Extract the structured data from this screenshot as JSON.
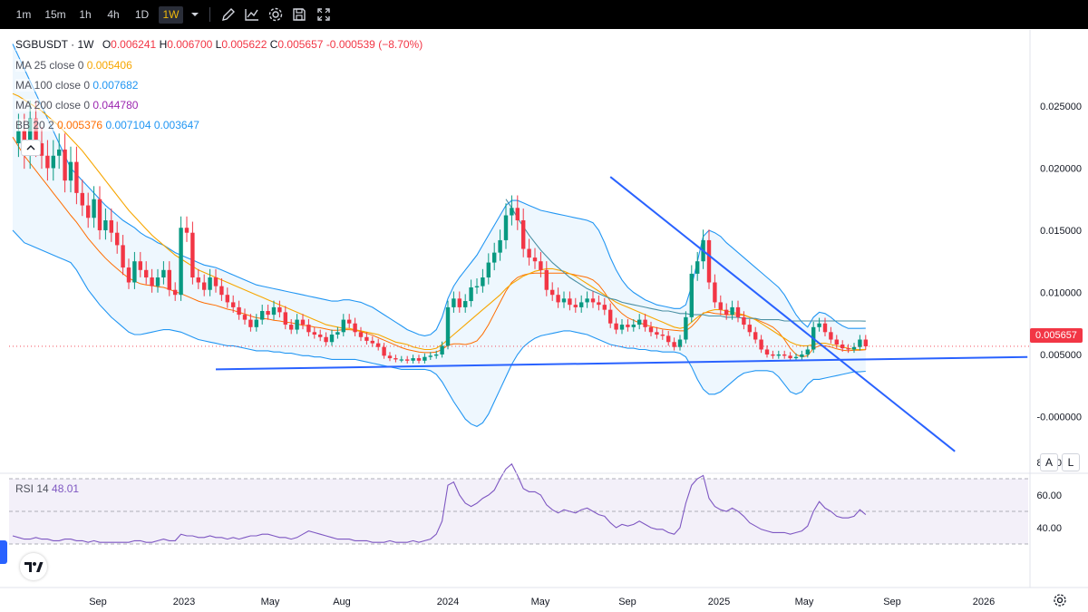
{
  "toolbar": {
    "timeframes": [
      "1m",
      "15m",
      "1h",
      "4h",
      "1D",
      "1W"
    ],
    "active": "1W",
    "icons": [
      "chevron-down-icon",
      "draw-icon",
      "indicators-icon",
      "settings-icon",
      "save-icon",
      "fullscreen-icon"
    ]
  },
  "legend": {
    "symbol": "SGBUSDT · 1W",
    "o_label": "O",
    "o": "0.006241",
    "h_label": "H",
    "h": "0.006700",
    "l_label": "L",
    "l": "0.005622",
    "c_label": "C",
    "c": "0.005657",
    "change": "-0.000539 (−8.70%)",
    "ma25_label": "MA 25 close 0",
    "ma25": "0.005406",
    "ma100_label": "MA 100 close 0",
    "ma100": "0.007682",
    "ma200_label": "MA 200 close 0",
    "ma200": "0.044780",
    "bb_label": "BB 20 2",
    "bb_basis": "0.005376",
    "bb_upper": "0.007104",
    "bb_lower": "0.003647"
  },
  "last_price": "0.005657",
  "rsi": {
    "label": "RSI 14",
    "value": "48.01"
  },
  "scale_buttons": [
    "A",
    "L"
  ],
  "colors": {
    "up": "#089981",
    "down": "#f23645",
    "ma25": "#f7a600",
    "ma100": "#2196f3",
    "bb": "#2196f3",
    "rsi": "#7e57c2",
    "trendline": "#2962ff"
  },
  "chart_data": {
    "type": "candlestick",
    "symbol": "SGBUSDT",
    "interval": "1W",
    "x_ticks": [
      "Sep",
      "2023",
      "May",
      "Aug",
      "2024",
      "May",
      "Sep",
      "2025",
      "May",
      "Sep",
      "2026"
    ],
    "y_ticks": [
      "0.025000",
      "0.020000",
      "0.015000",
      "0.010000",
      "0.005000",
      "-0.000000"
    ],
    "ylim": [
      -0.0042,
      0.0295
    ],
    "rsi_ticks": [
      "80.00",
      "60.00",
      "40.00"
    ],
    "rsi_ylim": [
      29,
      83
    ],
    "rsi_band": [
      30,
      70
    ],
    "grid": false,
    "closes": [
      0.022,
      0.023,
      0.021,
      0.024,
      0.022,
      0.021,
      0.02,
      0.021,
      0.0215,
      0.019,
      0.0205,
      0.018,
      0.017,
      0.016,
      0.0175,
      0.015,
      0.0158,
      0.0148,
      0.0138,
      0.012,
      0.0108,
      0.0125,
      0.0118,
      0.0112,
      0.0105,
      0.0112,
      0.0118,
      0.0102,
      0.0098,
      0.0152,
      0.0148,
      0.0112,
      0.0108,
      0.0102,
      0.0112,
      0.0105,
      0.0098,
      0.0092,
      0.0088,
      0.0082,
      0.0078,
      0.0072,
      0.0078,
      0.0085,
      0.0082,
      0.0088,
      0.0084,
      0.0074,
      0.007,
      0.0078,
      0.0074,
      0.0068,
      0.0066,
      0.0064,
      0.006,
      0.0066,
      0.0068,
      0.0078,
      0.0075,
      0.0068,
      0.0064,
      0.0061,
      0.0059,
      0.0056,
      0.0049,
      0.0047,
      0.0046,
      0.0046,
      0.0045,
      0.0047,
      0.0045,
      0.0048,
      0.0049,
      0.005,
      0.0057,
      0.0088,
      0.0095,
      0.0088,
      0.0093,
      0.0104,
      0.0105,
      0.0112,
      0.0124,
      0.0132,
      0.0142,
      0.0162,
      0.0168,
      0.0158,
      0.0135,
      0.0128,
      0.0125,
      0.0118,
      0.0102,
      0.0098,
      0.0092,
      0.0095,
      0.009,
      0.0088,
      0.0092,
      0.0095,
      0.0092,
      0.009,
      0.0086,
      0.0075,
      0.007,
      0.0074,
      0.0072,
      0.0074,
      0.0078,
      0.0072,
      0.0068,
      0.0066,
      0.0065,
      0.006,
      0.0056,
      0.0062,
      0.008,
      0.0115,
      0.0125,
      0.0142,
      0.0108,
      0.0092,
      0.0086,
      0.0082,
      0.0088,
      0.008,
      0.0074,
      0.0068,
      0.0062,
      0.0054,
      0.005,
      0.0049,
      0.005,
      0.0049,
      0.0047,
      0.0048,
      0.005,
      0.0054,
      0.0072,
      0.0075,
      0.0068,
      0.0062,
      0.0058,
      0.0055,
      0.0054,
      0.0056,
      0.0062,
      0.005657
    ],
    "bb_upper": [
      0.03,
      0.029,
      0.028,
      0.027,
      0.026,
      0.025,
      0.024,
      0.023,
      0.022,
      0.021,
      0.02,
      0.0195,
      0.019,
      0.0185,
      0.018,
      0.0175,
      0.017,
      0.0166,
      0.0162,
      0.0158,
      0.0155,
      0.0152,
      0.0148,
      0.0145,
      0.0143,
      0.014,
      0.0138,
      0.0135,
      0.0132,
      0.013,
      0.0128,
      0.0126,
      0.0124,
      0.0122,
      0.0121,
      0.012,
      0.0118,
      0.0116,
      0.0114,
      0.0112,
      0.011,
      0.0108,
      0.0106,
      0.0105,
      0.0104,
      0.0103,
      0.0102,
      0.0101,
      0.01,
      0.0099,
      0.0098,
      0.0097,
      0.0096,
      0.0095,
      0.0094,
      0.0093,
      0.0093,
      0.0094,
      0.0094,
      0.0093,
      0.0092,
      0.009,
      0.0088,
      0.0085,
      0.0082,
      0.0079,
      0.0076,
      0.0073,
      0.007,
      0.0068,
      0.0066,
      0.0065,
      0.0066,
      0.007,
      0.008,
      0.0095,
      0.0105,
      0.0112,
      0.0118,
      0.0124,
      0.013,
      0.0138,
      0.0146,
      0.0154,
      0.0162,
      0.017,
      0.0174,
      0.0174,
      0.0172,
      0.017,
      0.0168,
      0.0166,
      0.0165,
      0.0164,
      0.0163,
      0.0162,
      0.0161,
      0.016,
      0.0159,
      0.0158,
      0.0156,
      0.015,
      0.014,
      0.0128,
      0.0118,
      0.011,
      0.0104,
      0.01,
      0.0097,
      0.0094,
      0.0092,
      0.009,
      0.0089,
      0.0088,
      0.0087,
      0.0087,
      0.009,
      0.0105,
      0.0125,
      0.0145,
      0.015,
      0.0148,
      0.0145,
      0.014,
      0.0136,
      0.0132,
      0.0128,
      0.0124,
      0.012,
      0.0116,
      0.0112,
      0.0108,
      0.0104,
      0.0098,
      0.009,
      0.0082,
      0.0076,
      0.0072,
      0.008,
      0.0084,
      0.0083,
      0.008,
      0.0076,
      0.0073,
      0.0071,
      0.0071,
      0.0071,
      0.007104
    ],
    "bb_lower": [
      0.015,
      0.0145,
      0.014,
      0.0138,
      0.0136,
      0.0134,
      0.0132,
      0.013,
      0.0128,
      0.0126,
      0.0124,
      0.0118,
      0.011,
      0.0102,
      0.0096,
      0.009,
      0.0085,
      0.008,
      0.0076,
      0.0072,
      0.0068,
      0.0066,
      0.0066,
      0.0067,
      0.0068,
      0.0069,
      0.007,
      0.007,
      0.0069,
      0.0068,
      0.0066,
      0.0064,
      0.0062,
      0.0061,
      0.006,
      0.0059,
      0.0058,
      0.0057,
      0.0057,
      0.0056,
      0.0055,
      0.0054,
      0.0053,
      0.0053,
      0.0053,
      0.0052,
      0.0052,
      0.0051,
      0.0051,
      0.005,
      0.0049,
      0.0049,
      0.0048,
      0.0048,
      0.0047,
      0.0046,
      0.0046,
      0.0046,
      0.0046,
      0.0046,
      0.0045,
      0.0044,
      0.0043,
      0.0042,
      0.0041,
      0.004,
      0.0039,
      0.0038,
      0.0038,
      0.0038,
      0.0038,
      0.0038,
      0.0037,
      0.0034,
      0.0028,
      0.002,
      0.0012,
      0.0005,
      -0.0002,
      -0.0006,
      -0.0008,
      -0.0005,
      0.0002,
      0.0012,
      0.0022,
      0.0032,
      0.0042,
      0.005,
      0.0056,
      0.006,
      0.0063,
      0.0065,
      0.0066,
      0.0067,
      0.0068,
      0.0069,
      0.0069,
      0.0068,
      0.0067,
      0.0066,
      0.0064,
      0.0062,
      0.006,
      0.0058,
      0.0057,
      0.0056,
      0.0055,
      0.0055,
      0.0054,
      0.0054,
      0.0053,
      0.0053,
      0.0052,
      0.0052,
      0.0052,
      0.0051,
      0.0048,
      0.004,
      0.003,
      0.0022,
      0.0018,
      0.0018,
      0.002,
      0.0024,
      0.0028,
      0.0032,
      0.0035,
      0.0036,
      0.0037,
      0.0037,
      0.0037,
      0.0036,
      0.0032,
      0.0026,
      0.002,
      0.0018,
      0.002,
      0.0026,
      0.003,
      0.003,
      0.0031,
      0.0032,
      0.0033,
      0.0034,
      0.0035,
      0.0036,
      0.0036,
      0.003647
    ],
    "ma25": [
      0.026,
      0.0258,
      0.0255,
      0.0252,
      0.0249,
      0.0246,
      0.0242,
      0.0238,
      0.0234,
      0.0229,
      0.0224,
      0.0219,
      0.0214,
      0.0208,
      0.0202,
      0.0196,
      0.019,
      0.0184,
      0.0178,
      0.0172,
      0.0166,
      0.0161,
      0.0156,
      0.0151,
      0.0146,
      0.0142,
      0.0138,
      0.0134,
      0.013,
      0.0127,
      0.0124,
      0.0121,
      0.0118,
      0.0116,
      0.0114,
      0.0112,
      0.011,
      0.0108,
      0.0106,
      0.0104,
      0.0102,
      0.01,
      0.0098,
      0.0096,
      0.0094,
      0.0092,
      0.009,
      0.0088,
      0.0086,
      0.0084,
      0.0082,
      0.008,
      0.0078,
      0.0076,
      0.0074,
      0.0073,
      0.0072,
      0.0071,
      0.0071,
      0.007,
      0.0069,
      0.0068,
      0.0067,
      0.0066,
      0.0064,
      0.0062,
      0.006,
      0.0059,
      0.0058,
      0.0056,
      0.0055,
      0.0054,
      0.0054,
      0.0055,
      0.0058,
      0.0062,
      0.0066,
      0.007,
      0.0074,
      0.0078,
      0.0082,
      0.0086,
      0.009,
      0.0094,
      0.0098,
      0.0103,
      0.0107,
      0.011,
      0.0113,
      0.0115,
      0.0117,
      0.0118,
      0.0119,
      0.0119,
      0.0118,
      0.0117,
      0.0115,
      0.0113,
      0.011,
      0.0107,
      0.0104,
      0.0101,
      0.0098,
      0.0095,
      0.0092,
      0.009,
      0.0088,
      0.0086,
      0.0084,
      0.0082,
      0.008,
      0.0078,
      0.0076,
      0.0074,
      0.0072,
      0.0071,
      0.0072,
      0.0076,
      0.008,
      0.0083,
      0.0085,
      0.0086,
      0.0086,
      0.0085,
      0.0084,
      0.0083,
      0.0082,
      0.008,
      0.0078,
      0.0075,
      0.0072,
      0.0069,
      0.0066,
      0.0063,
      0.006,
      0.0058,
      0.0057,
      0.0057,
      0.0058,
      0.0059,
      0.0059,
      0.0058,
      0.0057,
      0.0056,
      0.0055,
      0.0054,
      0.0054,
      0.005406
    ],
    "ma100": [
      null,
      null,
      null,
      null,
      null,
      null,
      null,
      null,
      null,
      null,
      null,
      null,
      null,
      null,
      null,
      null,
      null,
      null,
      null,
      null,
      null,
      null,
      null,
      null,
      null,
      null,
      null,
      null,
      null,
      null,
      null,
      null,
      null,
      null,
      null,
      null,
      null,
      null,
      null,
      null,
      null,
      null,
      null,
      null,
      null,
      null,
      null,
      null,
      null,
      null,
      null,
      null,
      null,
      null,
      null,
      null,
      null,
      null,
      null,
      null,
      null,
      null,
      null,
      null,
      null,
      null,
      null,
      null,
      null,
      null,
      null,
      null,
      null,
      null,
      null,
      null,
      null,
      null,
      null,
      null,
      null,
      null,
      null,
      null,
      null,
      0.0175,
      0.0168,
      0.016,
      0.0153,
      0.0146,
      0.014,
      0.0134,
      0.0129,
      0.0124,
      0.012,
      0.0116,
      0.0112,
      0.0109,
      0.0106,
      0.0103,
      0.0101,
      0.0099,
      0.0097,
      0.0095,
      0.0094,
      0.0092,
      0.0091,
      0.009,
      0.0089,
      0.0088,
      0.0087,
      0.0086,
      0.0085,
      0.0085,
      0.0084,
      0.0083,
      0.0083,
      0.0082,
      0.0082,
      0.0082,
      0.0081,
      0.0081,
      0.0081,
      0.008,
      0.008,
      0.008,
      0.0079,
      0.0079,
      0.0079,
      0.0078,
      0.0078,
      0.0078,
      0.0078,
      0.0077,
      0.0077,
      0.0077,
      0.0077,
      0.0077,
      0.0077,
      0.0077,
      0.0077,
      0.0077,
      0.0077,
      0.0077,
      0.0077,
      0.0077,
      0.0077,
      0.007682
    ],
    "rsi_values": [
      35,
      34,
      33,
      33,
      34,
      33,
      33,
      32,
      32,
      33,
      33,
      32,
      32,
      31,
      32,
      31,
      31,
      31,
      31,
      31,
      31,
      32,
      32,
      31,
      31,
      32,
      33,
      32,
      32,
      36,
      35,
      35,
      34,
      34,
      35,
      34,
      34,
      33,
      34,
      33,
      34,
      35,
      35,
      36,
      36,
      35,
      34,
      34,
      33,
      34,
      36,
      38,
      37,
      36,
      35,
      34,
      33,
      33,
      33,
      32,
      32,
      32,
      31,
      31,
      31,
      32,
      31,
      31,
      31,
      32,
      31,
      32,
      33,
      36,
      44,
      66,
      68,
      60,
      55,
      53,
      55,
      58,
      60,
      63,
      70,
      76,
      79,
      72,
      64,
      62,
      62,
      60,
      54,
      51,
      49,
      51,
      50,
      49,
      51,
      52,
      50,
      48,
      47,
      43,
      40,
      42,
      41,
      42,
      44,
      42,
      40,
      39,
      39,
      37,
      36,
      40,
      55,
      66,
      70,
      72,
      58,
      53,
      51,
      50,
      52,
      50,
      47,
      43,
      41,
      39,
      38,
      37,
      37,
      37,
      36,
      37,
      38,
      41,
      50,
      56,
      52,
      50,
      47,
      46,
      46,
      47,
      51,
      48.01
    ],
    "trendlines": [
      {
        "name": "support",
        "from": [
          10,
          0.0038
        ],
        "to": [
          153,
          0.0048
        ]
      },
      {
        "name": "resistance",
        "from": [
          103,
          0.0193
        ],
        "to": [
          153,
          -0.0028
        ]
      }
    ]
  }
}
